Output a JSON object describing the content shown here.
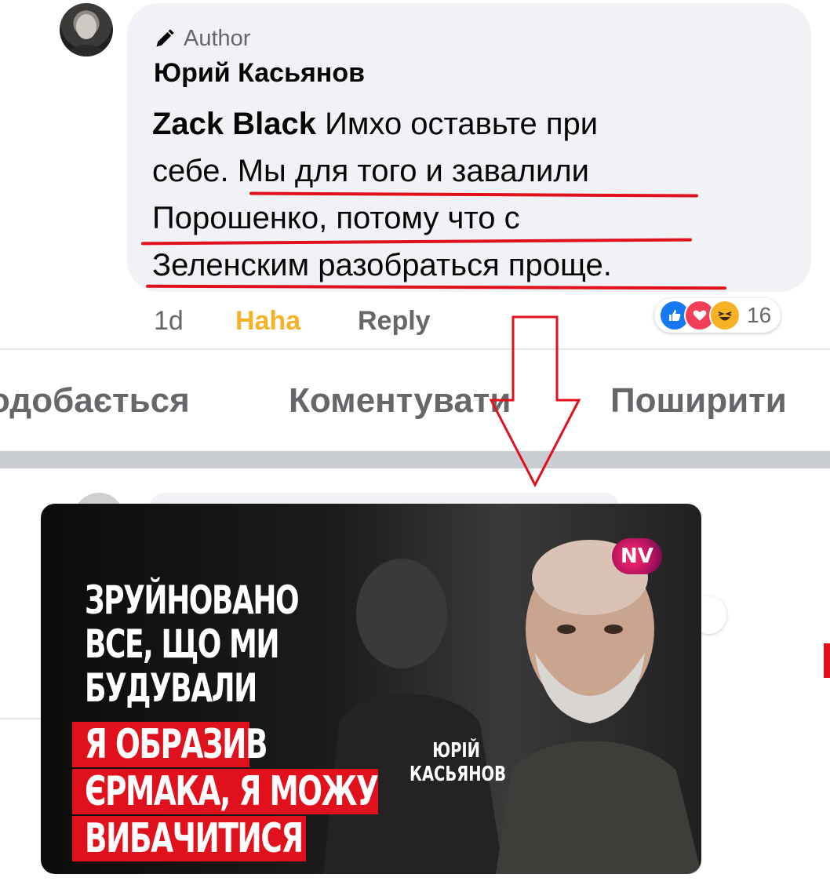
{
  "comment": {
    "badge_label": "Author",
    "author_name": "Юрий Касьянов",
    "mention": "Zack Black",
    "line1_rest": " Имхо оставьте при",
    "line2": "себе. Мы для того и завалили",
    "line3": "Порошенко, потому что с",
    "line4": "Зеленским разобраться проще.",
    "time": "1d",
    "reaction_label": "Haha",
    "reply_label": "Reply",
    "reaction_count": "16",
    "reactions": [
      "like-icon",
      "love-icon",
      "haha-icon"
    ],
    "underline_color": "#e0101c"
  },
  "post_actions": {
    "like_label": "одобається",
    "comment_label": "Коментувати",
    "share_label": "Поширити"
  },
  "thumbnail": {
    "title_lines": [
      "ЗРУЙНОВАНО",
      "ВСЕ, ЩО МИ",
      "БУДУВАЛИ"
    ],
    "highlight_lines": [
      "Я ОБРАЗИВ",
      "ЄРМАКА, Я МОЖУ",
      "ВИБАЧИТИСЯ"
    ],
    "caption_lines": [
      "ЮРІЙ",
      "КАСЬЯНОВ"
    ],
    "logo": "NV",
    "highlight_color": "#e0101c"
  },
  "annotation": {
    "arrow_color": "#e0101c",
    "arrow_direction": "down"
  }
}
